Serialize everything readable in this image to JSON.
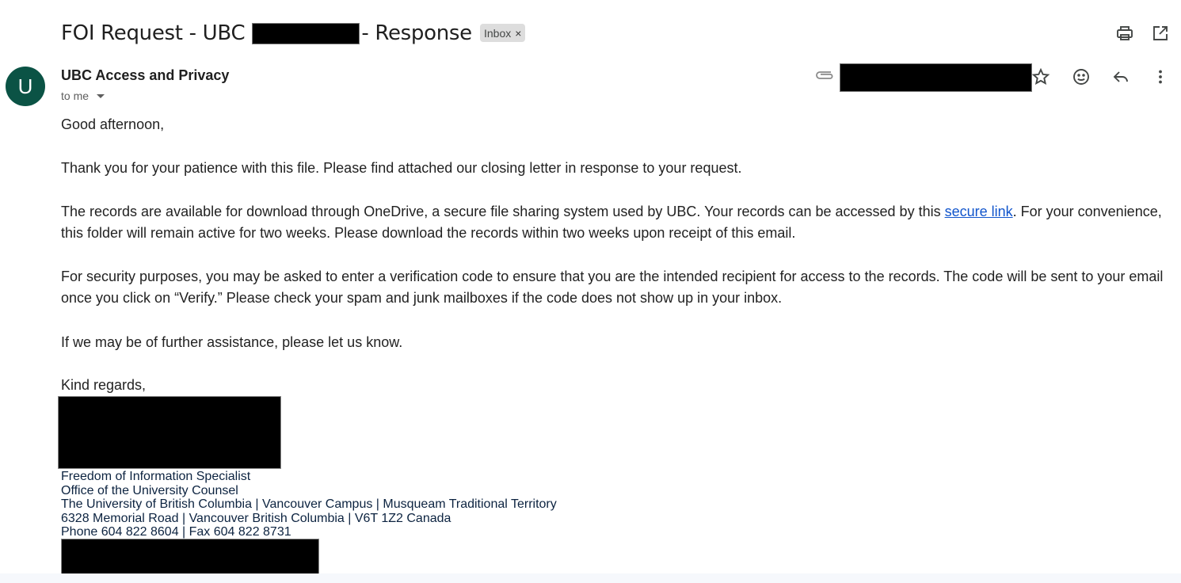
{
  "header": {
    "subject_prefix": "FOI Request - UBC",
    "subject_suffix": "- Response",
    "label": "Inbox",
    "label_remove": "×",
    "actions": [
      "print-icon",
      "open-in-new-window-icon"
    ]
  },
  "message": {
    "sender_initial": "U",
    "sender_name": "UBC Access and Privacy",
    "recipient_text": "to me",
    "header_icons": [
      "attachment-icon",
      "star-icon",
      "emoji-icon",
      "reply-icon",
      "more-vert-icon"
    ],
    "greeting": "Good afternoon,",
    "para1": "Thank you for your patience with this file. Please find attached our closing letter in response to your request.",
    "para2_before_link": "The records are available for download through OneDrive, a secure file sharing system used by UBC. Your records can be accessed by this ",
    "para2_link": "secure link",
    "para2_after_link": ". For your convenience, this folder will remain active for two weeks. Please download the records within two weeks upon receipt of this email.",
    "para3": "For security purposes, you may be asked to enter a verification code to ensure that you are the intended recipient for access to the records. The code will be sent to your email once you click on “Verify.” Please check your spam and junk mailboxes if the code does not show up in your inbox.",
    "para4": "If we may be of further assistance, please let us know.",
    "closing": "Kind regards,"
  },
  "signature": {
    "title": "Freedom of Information Specialist",
    "office": "Office of the University Counsel",
    "institution": "The University of British Columbia | Vancouver Campus | Musqueam Traditional Territory",
    "address": "6328 Memorial Road | Vancouver British Columbia | V6T 1Z2 Canada",
    "phone": "Phone 604 822 8604 | Fax 604 822 8731"
  },
  "colors": {
    "avatar_bg": "#0b5345",
    "link": "#1155cc",
    "signature_text": "#0c2340",
    "label_chip_bg": "#dddddd"
  }
}
